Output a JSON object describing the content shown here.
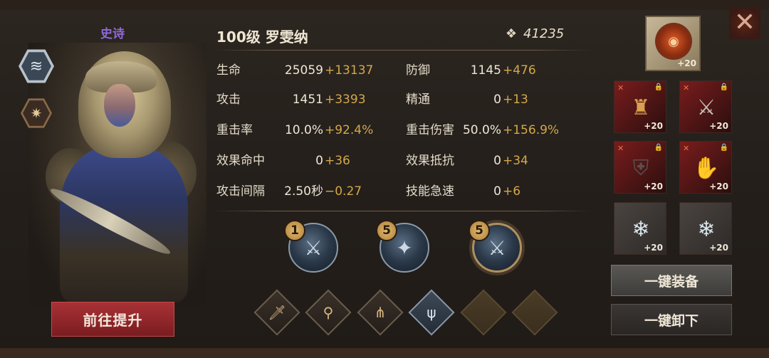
{
  "rarity": "史诗",
  "hero": {
    "name": "100级 罗雯纳",
    "power": "41235"
  },
  "stats": {
    "left": [
      {
        "label": "生命",
        "value": "25059",
        "bonus": "+13137"
      },
      {
        "label": "攻击",
        "value": "1451",
        "bonus": "+3393"
      },
      {
        "label": "重击率",
        "value": "10.0%",
        "bonus": "+92.4%"
      },
      {
        "label": "效果命中",
        "value": "0",
        "bonus": "+36"
      },
      {
        "label": "攻击间隔",
        "value": "2.50秒",
        "bonus": "−0.27"
      }
    ],
    "right": [
      {
        "label": "防御",
        "value": "1145",
        "bonus": "+476"
      },
      {
        "label": "精通",
        "value": "0",
        "bonus": "+13"
      },
      {
        "label": "重击伤害",
        "value": "50.0%",
        "bonus": "+156.9%"
      },
      {
        "label": "效果抵抗",
        "value": "0",
        "bonus": "+34"
      },
      {
        "label": "技能急速",
        "value": "0",
        "bonus": "+6"
      }
    ]
  },
  "skills": [
    {
      "level": "1",
      "icon": "claw-skill-icon"
    },
    {
      "level": "5",
      "icon": "star-skill-icon"
    },
    {
      "level": "5",
      "icon": "claw-ultimate-icon"
    }
  ],
  "slots": [
    "sword-icon",
    "sword-down-icon",
    "triple-blade-icon",
    "trident-icon",
    "empty-slot",
    "empty-slot"
  ],
  "equipment": {
    "accessory": {
      "level": "+20"
    },
    "items": [
      {
        "level": "+20",
        "locked": true,
        "icon": "armor-icon"
      },
      {
        "level": "+20",
        "locked": true,
        "icon": "dagger-icon"
      },
      {
        "level": "+20",
        "locked": true,
        "icon": "chest-armor-icon"
      },
      {
        "level": "+20",
        "locked": true,
        "icon": "gauntlet-icon"
      },
      {
        "level": "+20",
        "locked": false,
        "icon": "crystal-icon"
      },
      {
        "level": "+20",
        "locked": false,
        "icon": "crystal-icon"
      }
    ]
  },
  "buttons": {
    "upgrade": "前往提升",
    "equip_all": "一键装备",
    "unequip_all": "一键卸下"
  },
  "colors": {
    "bonus": "#d4a84a",
    "rarity": "#8e6ad8",
    "upgrade_button": "#a83236"
  }
}
